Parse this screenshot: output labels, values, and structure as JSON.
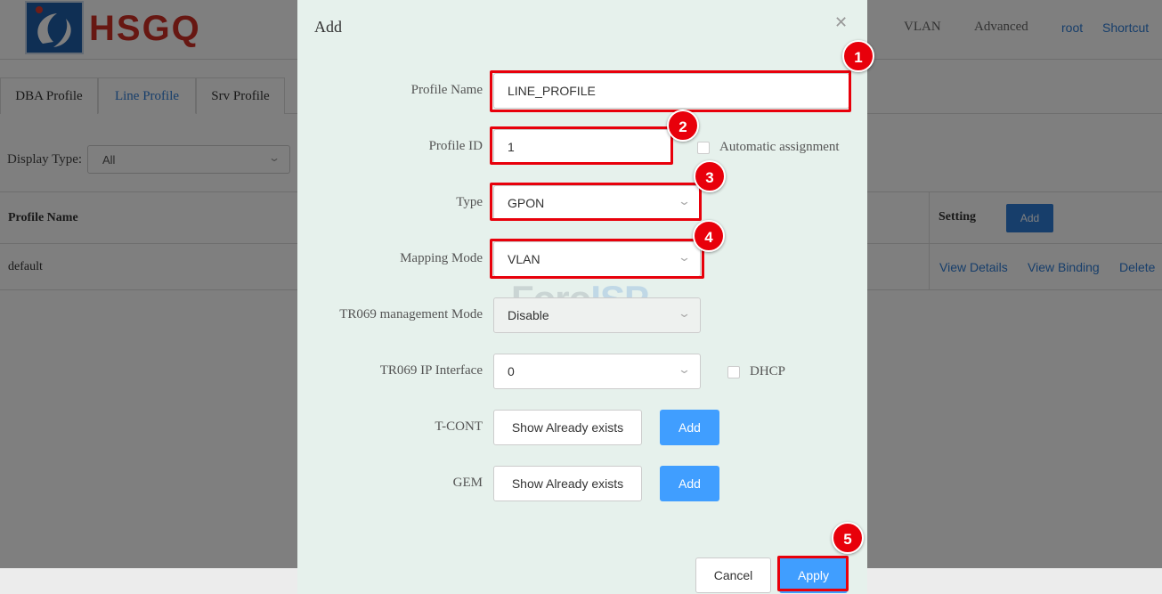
{
  "app": {
    "logo_text": "HSGQ",
    "nav": {
      "vlan": "VLAN",
      "advanced": "Advanced",
      "user": "root",
      "shortcut": "Shortcut"
    }
  },
  "tabs": [
    {
      "label": "DBA Profile",
      "active": false
    },
    {
      "label": "Line Profile",
      "active": true
    },
    {
      "label": "Srv Profile",
      "active": false
    }
  ],
  "filter": {
    "label": "Display Type:",
    "value": "All"
  },
  "table": {
    "headers": {
      "profile_name": "Profile Name",
      "setting": "Setting"
    },
    "add_label": "Add",
    "rows": [
      {
        "profile_name": "default",
        "actions": [
          "View Details",
          "View Binding",
          "Delete"
        ]
      }
    ]
  },
  "modal": {
    "title": "Add",
    "fields": {
      "profile_name": {
        "label": "Profile Name",
        "value": "LINE_PROFILE"
      },
      "profile_id": {
        "label": "Profile ID",
        "value": "1",
        "auto_label": "Automatic assignment"
      },
      "type": {
        "label": "Type",
        "value": "GPON"
      },
      "mapping_mode": {
        "label": "Mapping Mode",
        "value": "VLAN"
      },
      "tr069_mode": {
        "label": "TR069 management Mode",
        "value": "Disable"
      },
      "tr069_ip": {
        "label": "TR069 IP Interface",
        "value": "0",
        "dhcp_label": "DHCP"
      },
      "tcont": {
        "label": "T-CONT",
        "show_label": "Show Already exists",
        "add_label": "Add"
      },
      "gem": {
        "label": "GEM",
        "show_label": "Show Already exists",
        "add_label": "Add"
      }
    },
    "cancel_label": "Cancel",
    "apply_label": "Apply",
    "watermark": {
      "foro": "Foro",
      "isp": "ISP"
    }
  },
  "annotations": [
    "1",
    "2",
    "3",
    "4",
    "5"
  ],
  "colors": {
    "accent": "#409eff",
    "highlight": "#e8000b",
    "brand_red": "#cf2f24",
    "modal_bg": "#e6f1ec"
  }
}
